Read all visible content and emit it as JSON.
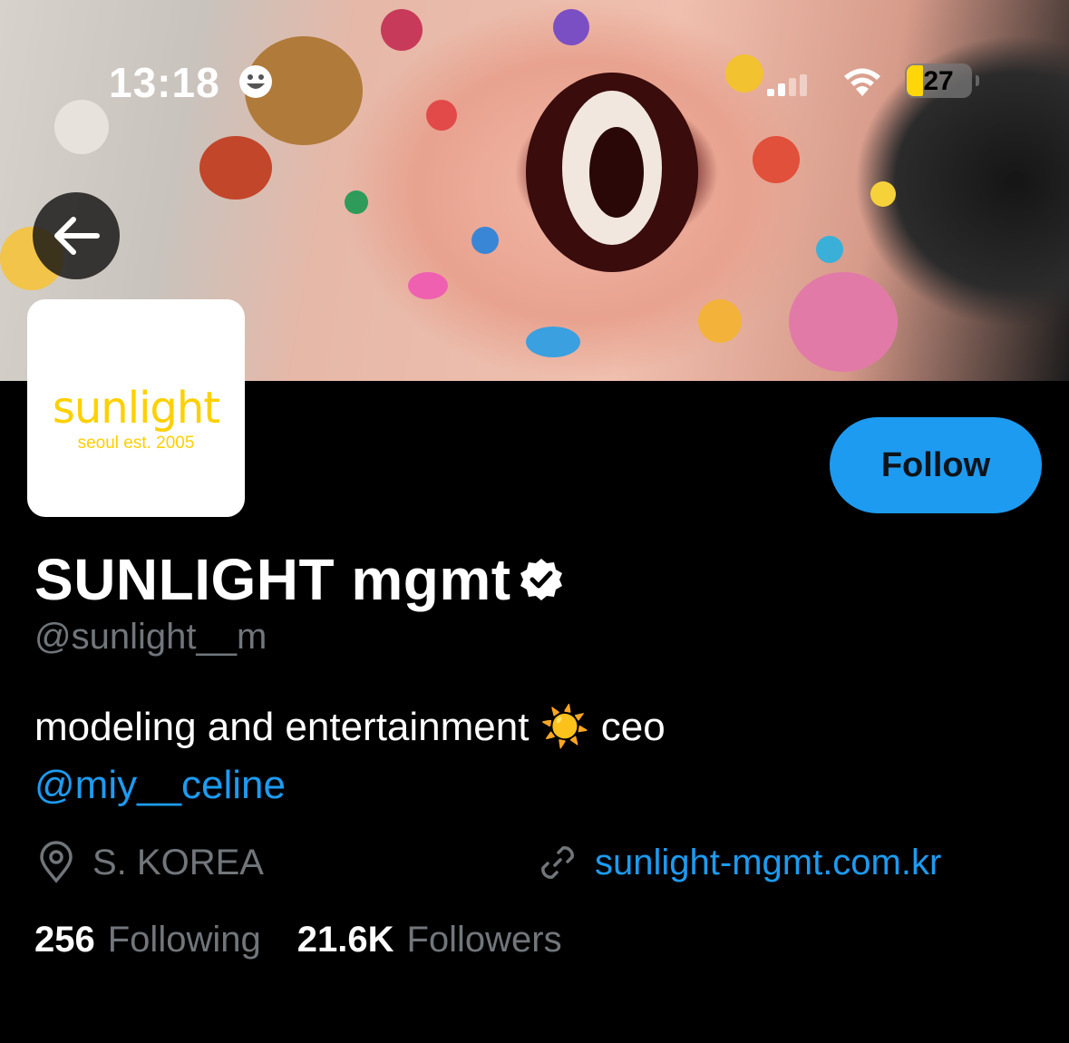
{
  "status_bar": {
    "time": "13:18",
    "battery_level": "27",
    "icons": [
      "face-emoji-icon",
      "cellular-signal-icon",
      "wifi-icon",
      "battery-icon"
    ]
  },
  "header": {
    "back_icon": "arrow-left-icon"
  },
  "avatar": {
    "brand": "sunlight",
    "tagline": "seoul est. 2005"
  },
  "profile": {
    "follow_label": "Follow",
    "display_name": "SUNLIGHT mgmt",
    "verified_icon": "verified-badge-icon",
    "handle": "@sunlight__m",
    "bio_text": "modeling and entertainment",
    "bio_emoji": "☀️",
    "bio_suffix": "ceo",
    "bio_mention": "@miy__celine",
    "location": "S. KOREA",
    "website": "sunlight-mgmt.com.kr",
    "following_count": "256",
    "following_label": "Following",
    "followers_count": "21.6K",
    "followers_label": "Followers"
  },
  "colors": {
    "accent": "#1d9bf0",
    "background": "#000000",
    "secondary_text": "#71767b",
    "brand_yellow": "#ffd000"
  }
}
